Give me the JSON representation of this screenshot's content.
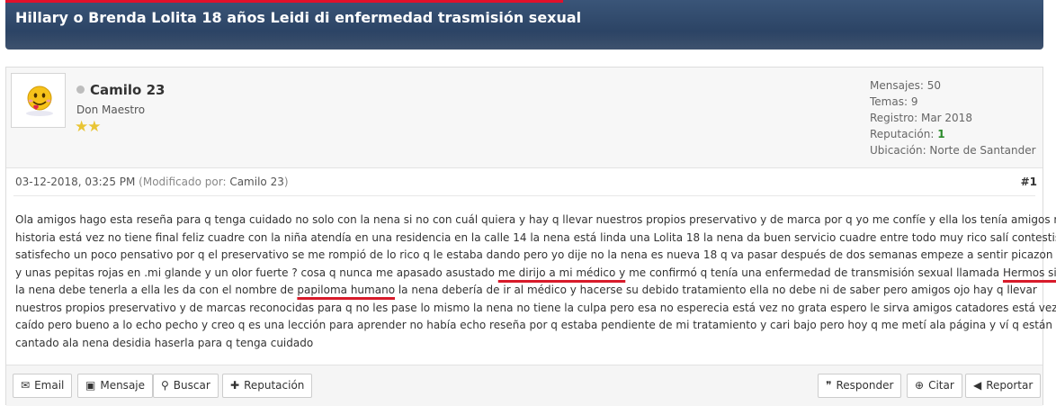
{
  "thread": {
    "title": "Hillary o Brenda Lolita 18 años Leidi di enfermedad trasmisión sexual"
  },
  "author": {
    "username": "Camilo 23",
    "user_title": "Don Maestro",
    "stars": "★★",
    "stats": {
      "messages": "Mensajes: 50",
      "topics": "Temas: 9",
      "registered": "Registro: Mar 2018",
      "reputation_label": "Reputación: ",
      "reputation_value": "1",
      "location": "Ubicación: Norte de Santander"
    }
  },
  "post": {
    "date": "03-12-2018, 03:25 PM",
    "edited_open": " (Modificado por: ",
    "edited_by": "Camilo 23",
    "edited_close": ")",
    "number": "#1",
    "lines": [
      "Ola amigos hago esta reseña para q tenga cuidado no solo con la nena si no con cuál quiera y hay q llevar nuestros propios preservativo y de marca por q yo me confíe y ella los tenía amigos mi",
      "historia está vez no tiene final feliz cuadre con la niña atendía en una residencia en la calle 14 la nena está linda una Lolita 18 la nena da buen servicio cuadre entre todo muy rico salí contestisimo",
      "satisfecho un poco pensativo por q el preservativo se me rompió de lo rico q le estaba dando pero yo dije no la nena es nueva 18 q va pasar después de dos semanas empeze a sentir picazon ardor",
      "y unas pepitas rojas en .mi glande y un olor fuerte ? cosa q nunca me apasado asustado ",
      "me dirijo a mi médico y",
      " me confirmó q tenía una enfermedad de transmisión sexual llamada ",
      "Hermos simple",
      "la nena debe tenerla a ella les da con el nombre de ",
      "papiloma humano",
      " la nena debería de ir al médico y hacerse su debido tratamiento ella no debe ni de saber pero amigos ojo hay q llevar",
      "nuestros propios preservativo y de marcas reconocidas para q no les pase lo mismo la nena no tiene la culpa pero esa no esperecia está vez no grata espero le sirva amigos catadores está vez fui",
      "caído pero bueno a lo echo pecho y creo q es una lección para aprender no había echo reseña por q estaba pendiente de mi tratamiento y cari bajo pero hoy q me metí ala página y ví q están",
      "cantado ala nena desidia haserla para q tenga cuidado"
    ]
  },
  "buttons": {
    "email": "Email",
    "message": "Mensaje",
    "search": "Buscar",
    "reputation": "Reputación",
    "reply": "Responder",
    "quote": "Citar",
    "report": "Reportar"
  },
  "icons": {
    "email": "envelope-icon",
    "message": "message-icon",
    "search": "search-icon",
    "reputation": "plus-icon",
    "reply": "quote-icon",
    "quote": "plus-circle-icon",
    "report": "bullhorn-icon"
  },
  "colors": {
    "header_bg": "#2c4466",
    "header_accent": "#e2102b",
    "annotation_underline": "#d81b2b",
    "reputation_value": "#2a8a2a"
  }
}
